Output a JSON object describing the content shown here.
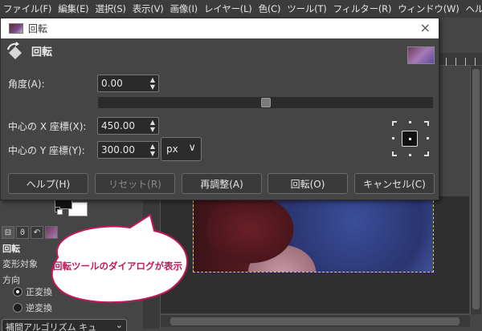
{
  "menubar": {
    "items": [
      "ファイル(F)",
      "編集(E)",
      "選択(S)",
      "表示(V)",
      "画像(I)",
      "レイヤー(L)",
      "色(C)",
      "ツール(T)",
      "フィルター(R)",
      "ウィンドウ(W)",
      "ヘルプ(H)"
    ]
  },
  "dialog": {
    "window_title": "回転",
    "heading": "回転",
    "close_glyph": "×",
    "angle": {
      "label": "角度(A):",
      "value": "0.00",
      "slider_fraction": 0.5
    },
    "center_x": {
      "label": "中心の X 座標(X):",
      "value": "450.00"
    },
    "center_y": {
      "label": "中心の Y 座標(Y):",
      "value": "300.00"
    },
    "unit": {
      "value": "px",
      "arrow": "∨"
    },
    "buttons": {
      "help": "ヘルプ(H)",
      "reset": "リセット(R)",
      "readjust": "再調整(A)",
      "rotate": "回転(O)",
      "cancel": "キャンセル(C)"
    },
    "spin_up": "▲",
    "spin_down": "▼"
  },
  "tool_options": {
    "title": "回転",
    "transform_label": "変形対象",
    "direction_label": "方向",
    "direction_normal": "正変換",
    "direction_reverse": "逆変換",
    "interpolation": "補間アルゴリズム キュ",
    "interpolation_arrow": "⌄"
  },
  "callout": {
    "text": "回転ツールのダイアログが表示",
    "border_color": "#c2185b",
    "text_color": "#c2185b"
  },
  "icons": {
    "rotate_tool": "rotate-icon",
    "close": "close-icon",
    "pivot": "pivot-icon"
  }
}
